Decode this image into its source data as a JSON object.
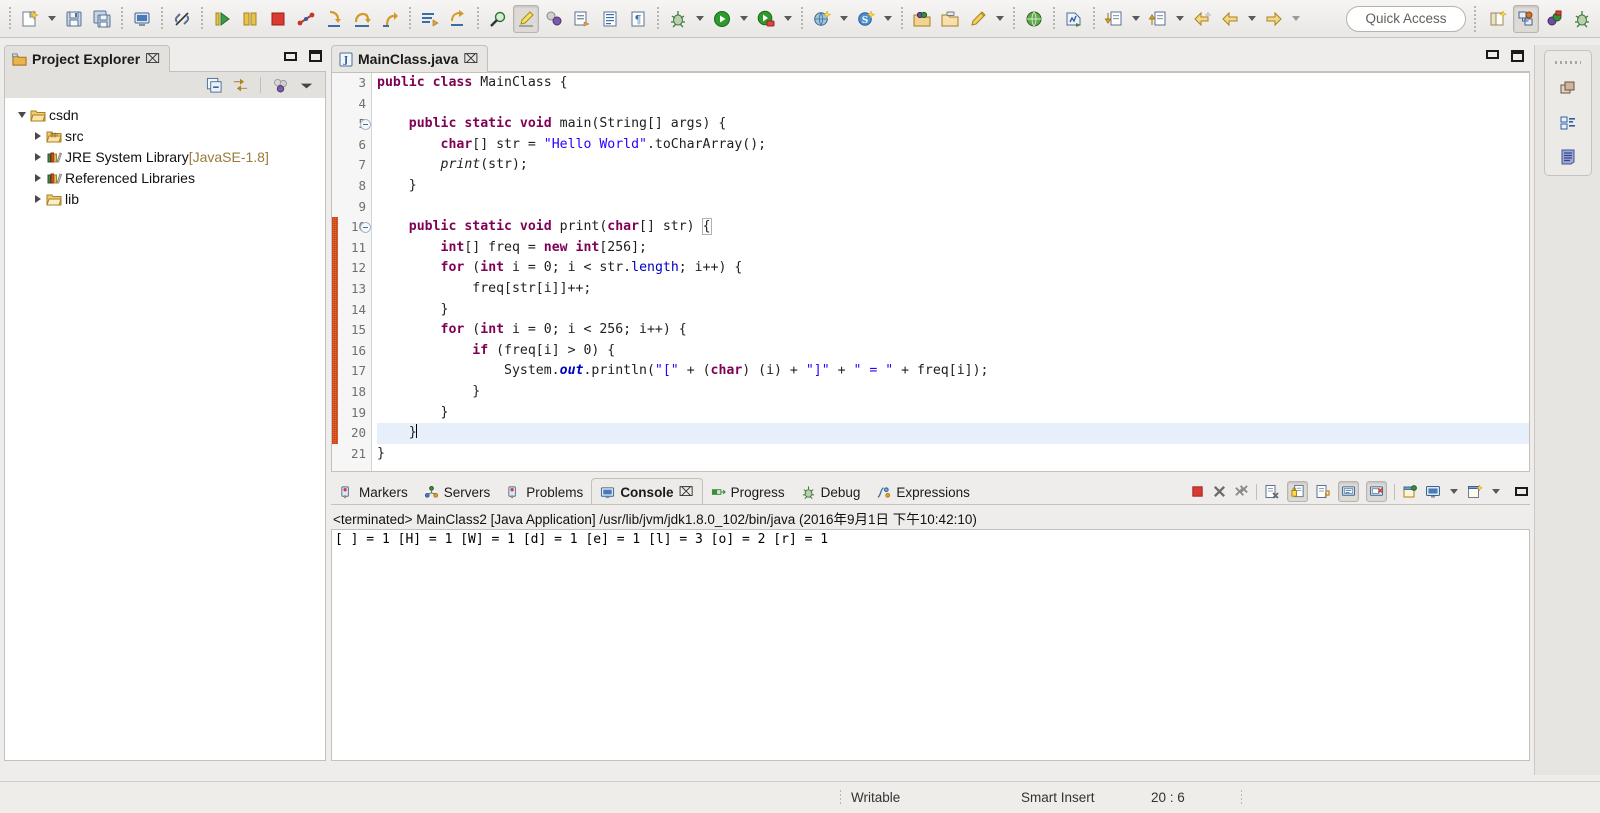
{
  "window": {
    "quick_access": "Quick Access"
  },
  "toolbar": {
    "groups": [
      {
        "name": "file",
        "items": [
          {
            "icon": "new-wizard-icon",
            "label": "New"
          },
          {
            "icon": "chevron-down-icon",
            "label": "New dropdown"
          },
          {
            "icon": "save-icon",
            "label": "Save"
          },
          {
            "icon": "save-all-icon",
            "label": "Save All"
          }
        ]
      },
      {
        "name": "print",
        "items": [
          {
            "icon": "print-icon",
            "label": "Print"
          }
        ]
      },
      {
        "name": "link",
        "items": [
          {
            "icon": "link-broken-icon",
            "label": "Toggle Link"
          }
        ]
      },
      {
        "name": "debug-controls",
        "items": [
          {
            "icon": "resume-icon",
            "label": "Resume"
          },
          {
            "icon": "suspend-icon",
            "label": "Suspend"
          },
          {
            "icon": "terminate-icon",
            "label": "Terminate"
          },
          {
            "icon": "disconnect-icon",
            "label": "Disconnect"
          },
          {
            "icon": "step-into-icon",
            "label": "Step Into"
          },
          {
            "icon": "step-over-icon",
            "label": "Step Over"
          },
          {
            "icon": "step-return-icon",
            "label": "Step Return"
          }
        ]
      },
      {
        "name": "editor-actions",
        "items": [
          {
            "icon": "open-declaration-icon",
            "label": "Open Declaration"
          },
          {
            "icon": "next-annotation-icon",
            "label": "Next Annotation"
          }
        ]
      },
      {
        "name": "search-group",
        "items": [
          {
            "icon": "search-icon",
            "label": "Search"
          },
          {
            "icon": "marker-pen-icon",
            "label": "Toggle Mark Occurrences",
            "pressed": true
          },
          {
            "icon": "skip-breakpoints-icon",
            "label": "Skip All Breakpoints"
          },
          {
            "icon": "open-task-icon",
            "label": "Open Task"
          },
          {
            "icon": "show-whitespace-icon",
            "label": "Show Whitespace Characters"
          },
          {
            "icon": "pilcrow-icon",
            "label": "Show Print Margin"
          }
        ]
      },
      {
        "name": "run-group",
        "items": [
          {
            "icon": "debug-icon",
            "label": "Debug"
          },
          {
            "icon": "chevron-down-icon",
            "label": "Debug dropdown"
          },
          {
            "icon": "run-icon",
            "label": "Run"
          },
          {
            "icon": "chevron-down-icon",
            "label": "Run dropdown"
          },
          {
            "icon": "run-external-tools-icon",
            "label": "External Tools"
          },
          {
            "icon": "chevron-down-icon",
            "label": "External Tools dropdown"
          }
        ]
      },
      {
        "name": "web-group",
        "items": [
          {
            "icon": "new-web-project-icon",
            "label": "New Web Project"
          },
          {
            "icon": "new-web-service-icon",
            "label": "New Web Service"
          },
          {
            "icon": "chevron-down-icon",
            "label": "Web Service dropdown"
          },
          {
            "icon": "new-server-icon",
            "label": "New Server"
          },
          {
            "icon": "chevron-down-icon",
            "label": "New Server dropdown"
          }
        ]
      },
      {
        "name": "package-group",
        "items": [
          {
            "icon": "new-package-icon",
            "label": "New Java Package"
          },
          {
            "icon": "new-class-icon",
            "label": "New Java Class"
          },
          {
            "icon": "new-annotation-icon",
            "label": "New Annotation"
          },
          {
            "icon": "chevron-down-icon",
            "label": "New Type dropdown"
          }
        ]
      },
      {
        "name": "browser-group",
        "items": [
          {
            "icon": "web-browser-icon",
            "label": "Open Web Browser"
          }
        ]
      },
      {
        "name": "profile-group",
        "items": [
          {
            "icon": "profile-icon",
            "label": "Profile"
          }
        ]
      },
      {
        "name": "svn-group",
        "items": [
          {
            "icon": "svn-update-icon",
            "label": "Update"
          },
          {
            "icon": "chevron-down-icon",
            "label": "Update dropdown"
          },
          {
            "icon": "svn-commit-icon",
            "label": "Commit"
          },
          {
            "icon": "chevron-down-icon",
            "label": "Commit dropdown"
          }
        ]
      },
      {
        "name": "nav-group",
        "items": [
          {
            "icon": "last-edit-location-icon",
            "label": "Last Edit Location"
          },
          {
            "icon": "back-icon",
            "label": "Back"
          },
          {
            "icon": "chevron-down-icon",
            "label": "Back dropdown"
          },
          {
            "icon": "forward-icon",
            "label": "Forward"
          },
          {
            "icon": "chevron-down-icon",
            "label": "Forward dropdown"
          }
        ]
      }
    ],
    "perspective": [
      {
        "icon": "open-perspective-icon",
        "label": "Open Perspective"
      },
      {
        "icon": "java-ee-perspective-icon",
        "label": "Java EE",
        "pressed": true
      },
      {
        "icon": "java-perspective-icon",
        "label": "Java"
      },
      {
        "icon": "debug-perspective-icon",
        "label": "Debug"
      }
    ]
  },
  "project_explorer": {
    "title": "Project Explorer",
    "close_label": "⌧",
    "minimize_label": "Minimize",
    "maximize_label": "Maximize",
    "toolbar": [
      {
        "icon": "collapse-all-icon",
        "label": "Collapse All"
      },
      {
        "icon": "link-with-editor-icon",
        "label": "Link With Editor"
      },
      {
        "icon": "view-menu-filters-icon",
        "label": "Filters"
      },
      {
        "icon": "view-menu-icon",
        "label": "View Menu"
      }
    ],
    "tree": [
      {
        "label": "csdn",
        "icon": "project-folder-icon",
        "expanded": true,
        "depth": 0
      },
      {
        "label": "src",
        "icon": "source-folder-icon",
        "expanded": false,
        "depth": 1
      },
      {
        "label": "JRE System Library ",
        "suffix": "[JavaSE-1.8]",
        "icon": "library-icon",
        "expanded": false,
        "depth": 1
      },
      {
        "label": "Referenced Libraries",
        "icon": "library-icon",
        "expanded": false,
        "depth": 1
      },
      {
        "label": "lib",
        "icon": "folder-icon",
        "expanded": false,
        "depth": 1
      }
    ]
  },
  "editor": {
    "tab": {
      "label": "MainClass.java",
      "icon": "java-file-icon",
      "close_label": "⌧"
    },
    "minimize_label": "Minimize",
    "maximize_label": "Maximize",
    "first_visible_line": 3,
    "current_line": 20,
    "change_bar_from": 10,
    "change_bar_to": 20,
    "lines": [
      {
        "n": 3,
        "html": "<span class=\"kw\">public class</span> MainClass {"
      },
      {
        "n": 4,
        "html": ""
      },
      {
        "n": 5,
        "html": "    <span class=\"kw\">public static void</span> main(String[] args) {",
        "fold": true
      },
      {
        "n": 6,
        "html": "        <span class=\"kw\">char</span>[] str = <span class=\"str\">\"Hello World\"</span>.toCharArray();"
      },
      {
        "n": 7,
        "html": "        <span class=\"st\">print</span>(str);"
      },
      {
        "n": 8,
        "html": "    }"
      },
      {
        "n": 9,
        "html": ""
      },
      {
        "n": 10,
        "html": "    <span class=\"kw\">public static void</span> print(<span class=\"kw\">char</span>[] str) <span class=\"brace-box\">{</span>",
        "fold": true
      },
      {
        "n": 11,
        "html": "        <span class=\"kw\">int</span>[] freq = <span class=\"kw\">new int</span>[256];"
      },
      {
        "n": 12,
        "html": "        <span class=\"kw\">for</span> (<span class=\"kw\">int</span> i = 0; i &lt; str.<span class=\"fld\">length</span>; i++) {"
      },
      {
        "n": 13,
        "html": "            freq[str[i]]++;"
      },
      {
        "n": 14,
        "html": "        }"
      },
      {
        "n": 15,
        "html": "        <span class=\"kw\">for</span> (<span class=\"kw\">int</span> i = 0; i &lt; 256; i++) {"
      },
      {
        "n": 16,
        "html": "            <span class=\"kw\">if</span> (freq[i] &gt; 0) {"
      },
      {
        "n": 17,
        "html": "                System.<span class=\"stb\">out</span>.println(<span class=\"str\">\"[\"</span> + (<span class=\"kw\">char</span>) (i) + <span class=\"str\">\"]\"</span> + <span class=\"str\">\" = \"</span> + freq[i]);"
      },
      {
        "n": 18,
        "html": "            }"
      },
      {
        "n": 19,
        "html": "        }"
      },
      {
        "n": 20,
        "html": "    }<span class=\"cursor\"></span>"
      },
      {
        "n": 21,
        "html": "}"
      }
    ]
  },
  "bottom_panel": {
    "tabs": [
      {
        "label": "Markers",
        "icon": "markers-icon",
        "active": false
      },
      {
        "label": "Servers",
        "icon": "servers-icon",
        "active": false
      },
      {
        "label": "Problems",
        "icon": "problems-icon",
        "active": false
      },
      {
        "label": "Console",
        "icon": "console-icon",
        "active": true,
        "close_label": "⌧"
      },
      {
        "label": "Progress",
        "icon": "progress-icon",
        "active": false
      },
      {
        "label": "Debug",
        "icon": "debug-view-icon",
        "active": false
      },
      {
        "label": "Expressions",
        "icon": "expressions-icon",
        "active": false
      }
    ],
    "toolbar": [
      {
        "icon": "terminate-icon",
        "label": "Terminate"
      },
      {
        "icon": "remove-launch-icon",
        "label": "Remove Launch"
      },
      {
        "icon": "remove-all-terminated-icon",
        "label": "Remove All Terminated Launches"
      },
      {
        "icon": "clear-console-icon",
        "label": "Clear Console"
      },
      {
        "icon": "scroll-lock-icon",
        "label": "Scroll Lock",
        "pressed": true
      },
      {
        "icon": "word-wrap-icon",
        "label": "Word Wrap"
      },
      {
        "icon": "show-console-on-output-icon",
        "label": "Show Console When Standard Out Changes",
        "pressed": true
      },
      {
        "icon": "show-console-on-error-icon",
        "label": "Show Console When Standard Error Changes",
        "pressed": true
      },
      {
        "icon": "pin-console-icon",
        "label": "Pin Console"
      },
      {
        "icon": "display-selected-console-icon",
        "label": "Display Selected Console"
      },
      {
        "icon": "chevron-down-icon",
        "label": "Display Selected Console dropdown"
      },
      {
        "icon": "open-console-icon",
        "label": "Open Console"
      },
      {
        "icon": "chevron-down-icon",
        "label": "Open Console dropdown"
      },
      {
        "icon": "minimize-icon",
        "label": "Minimize"
      },
      {
        "icon": "maximize-icon",
        "label": "Maximize"
      }
    ],
    "console": {
      "header": "<terminated> MainClass2 [Java Application] /usr/lib/jvm/jdk1.8.0_102/bin/java (2016年9月1日 下午10:42:10)",
      "output": "[ ] = 1\n[H] = 1\n[W] = 1\n[d] = 1\n[e] = 1\n[l] = 3\n[o] = 2\n[r] = 1"
    }
  },
  "fast_view": {
    "items": [
      {
        "icon": "restore-view-icon",
        "label": "Restore"
      },
      {
        "icon": "outline-view-icon",
        "label": "Outline"
      },
      {
        "icon": "task-list-view-icon",
        "label": "Task List"
      }
    ]
  },
  "status_bar": {
    "writable": "Writable",
    "insert_mode": "Smart Insert",
    "position": "20 : 6"
  },
  "colors": {
    "keyword": "#7f0055",
    "string": "#2a00ff",
    "field": "#0000c0",
    "change_bar": "#f0a875",
    "current_line": "#e7f0fa",
    "accent": "#3a6ea5"
  }
}
